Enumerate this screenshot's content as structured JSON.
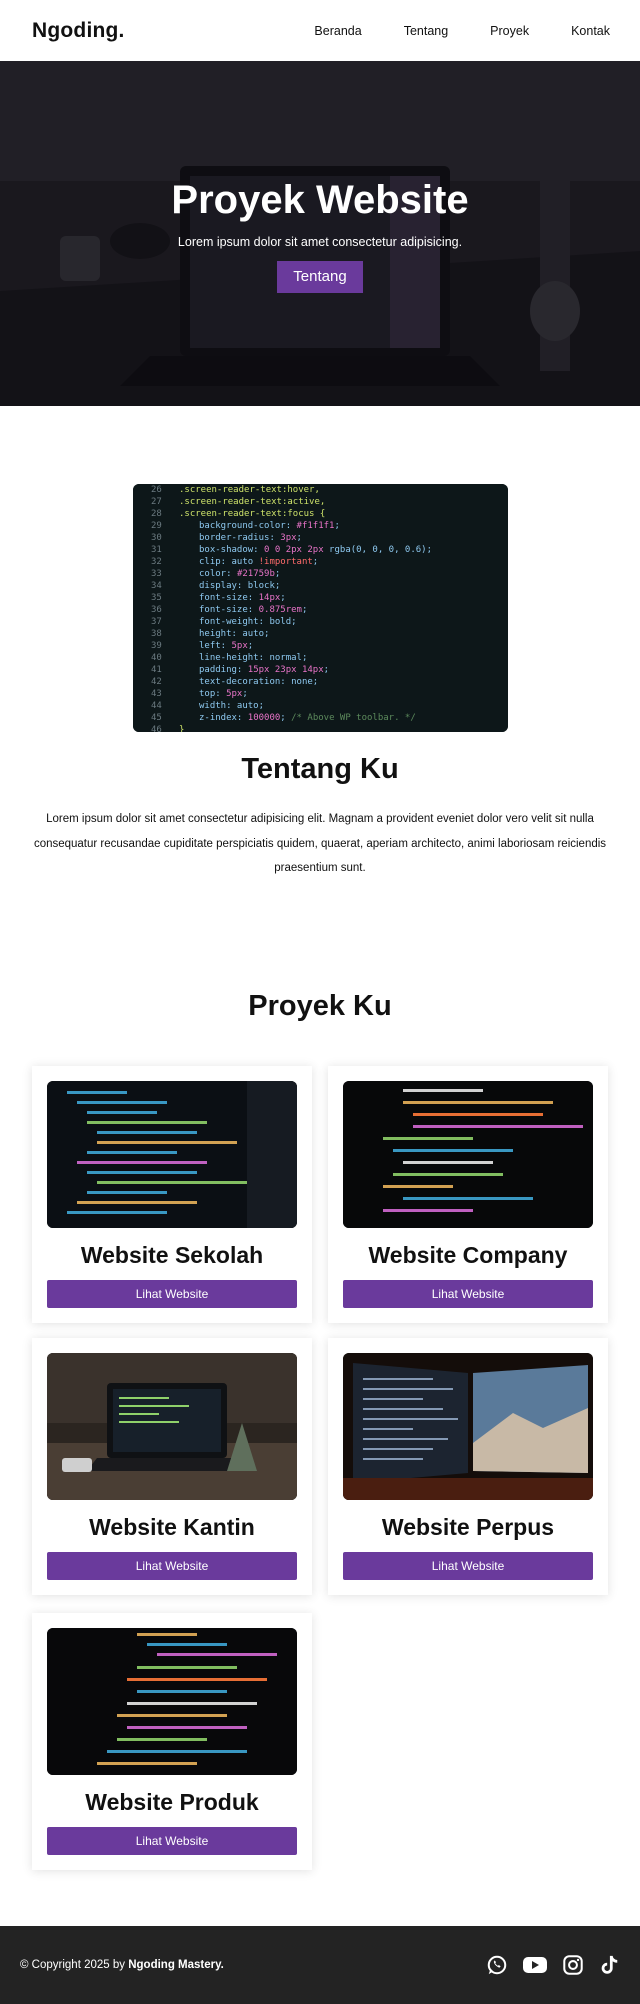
{
  "nav": {
    "brand": "Ngoding.",
    "links": [
      "Beranda",
      "Tentang",
      "Proyek",
      "Kontak"
    ]
  },
  "hero": {
    "title": "Proyek Website",
    "subtitle": "Lorem ipsum dolor sit amet consectetur adipisicing.",
    "button": "Tentang"
  },
  "about": {
    "title": "Tentang Ku",
    "text": "Lorem ipsum dolor sit amet consectetur adipisicing elit. Magnam a provident eveniet dolor vero velit sit nulla consequatur recusandae cupiditate perspiciatis quidem, quaerat, aperiam architecto, animi laboriosam reiciendis praesentium sunt."
  },
  "projects": {
    "title": "Proyek Ku",
    "items": [
      {
        "name": "Website Sekolah",
        "button": "Lihat Website"
      },
      {
        "name": "Website Company",
        "button": "Lihat Website"
      },
      {
        "name": "Website Kantin",
        "button": "Lihat Website"
      },
      {
        "name": "Website Perpus",
        "button": "Lihat Website"
      },
      {
        "name": "Website Produk",
        "button": "Lihat Website"
      }
    ]
  },
  "footer": {
    "copyright_prefix": "© Copyright 2025 by",
    "owner": "Ngoding Mastery.",
    "socials": [
      "whatsapp-icon",
      "youtube-icon",
      "instagram-icon",
      "tiktok-icon"
    ]
  },
  "colors": {
    "accent": "#6a3a9c",
    "footer_bg": "#232323",
    "hero_overlay": "#1b1a1f"
  }
}
